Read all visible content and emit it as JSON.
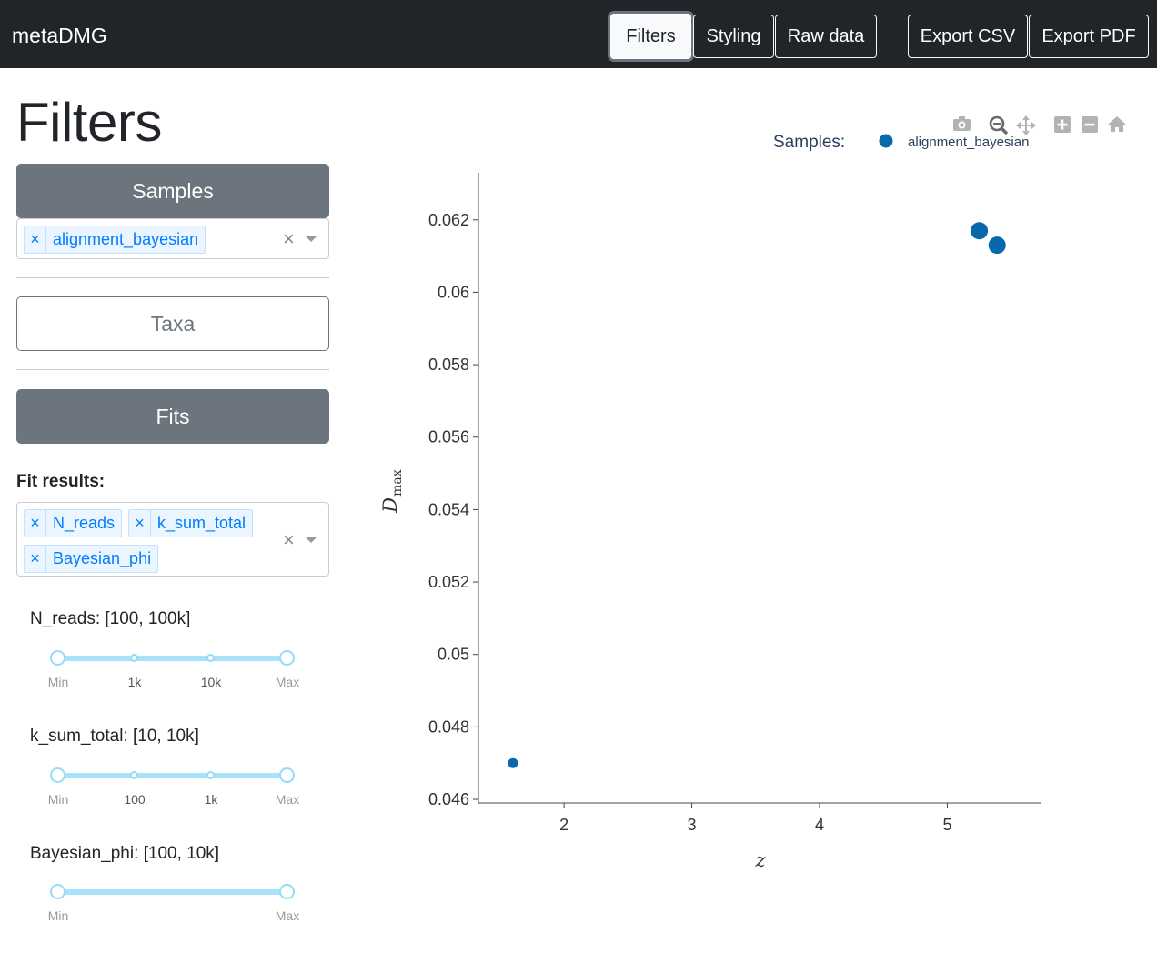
{
  "brand": "metaDMG",
  "nav": {
    "tabs": [
      "Filters",
      "Styling",
      "Raw data"
    ],
    "exports": [
      "Export CSV",
      "Export PDF"
    ]
  },
  "page_title": "Filters",
  "sidebar": {
    "samples_button": "Samples",
    "samples_tags": [
      "alignment_bayesian"
    ],
    "taxa_button": "Taxa",
    "fits_button": "Fits",
    "fit_results_label": "Fit results:",
    "fit_results_tags": [
      "N_reads",
      "k_sum_total",
      "Bayesian_phi"
    ],
    "sliders": [
      {
        "label": "N_reads: [100, 100k]",
        "marks": [
          "Min",
          "1k",
          "10k",
          "Max"
        ]
      },
      {
        "label": "k_sum_total: [10, 10k]",
        "marks": [
          "Min",
          "100",
          "1k",
          "Max"
        ]
      },
      {
        "label": "Bayesian_phi: [100, 10k]",
        "marks": [
          "Min",
          "Max"
        ]
      }
    ]
  },
  "colors": {
    "navbar": "#212529",
    "marker": "#0868ac",
    "accent": "#007eff"
  },
  "chart_data": {
    "type": "scatter",
    "legend_title": "Samples:",
    "legend_placement": "top-right",
    "xlabel": "z",
    "ylabel": "D_max",
    "xlim": [
      1.33,
      5.73
    ],
    "ylim": [
      0.0459,
      0.0633
    ],
    "x_ticks": [
      "2",
      "3",
      "4",
      "5"
    ],
    "y_ticks": [
      "0.046",
      "0.048",
      "0.05",
      "0.052",
      "0.054",
      "0.056",
      "0.058",
      "0.06",
      "0.062"
    ],
    "grid": false,
    "series": [
      {
        "name": "alignment_bayesian",
        "points": [
          {
            "x": 5.25,
            "y": 0.0617,
            "size": "large"
          },
          {
            "x": 5.39,
            "y": 0.0613,
            "size": "large"
          },
          {
            "x": 1.6,
            "y": 0.047,
            "size": "small"
          }
        ]
      }
    ]
  }
}
